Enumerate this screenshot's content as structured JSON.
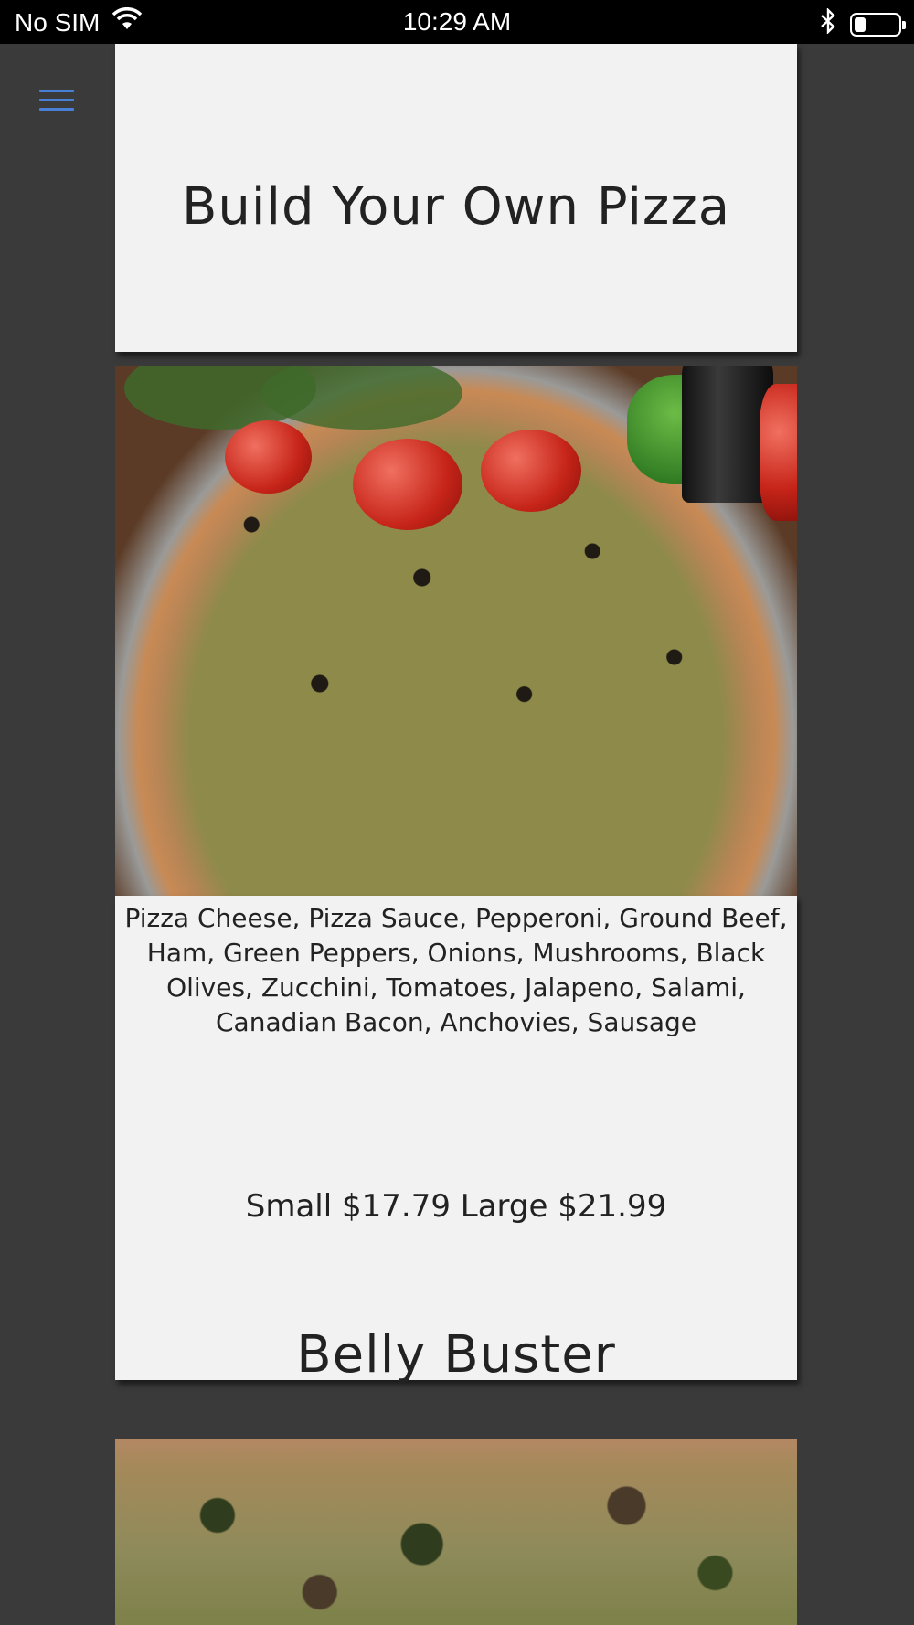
{
  "status_bar": {
    "carrier": "No SIM",
    "time": "10:29 AM",
    "battery_level": 0.25
  },
  "icons": {
    "menu": "hamburger-menu-icon",
    "wifi": "wifi-icon",
    "bluetooth": "bluetooth-icon",
    "battery": "battery-icon"
  },
  "colors": {
    "menu_accent": "#4a7fd6",
    "page_background": "#3a3a3a",
    "card_background": "#f2f2f2"
  },
  "menu_items": [
    {
      "title": "Build Your Own Pizza",
      "photo": "pizza-photo",
      "description": "Pizza Cheese, Pizza Sauce, Pepperoni, Ground Beef, Ham, Green Peppers, Onions, Mushrooms, Black Olives, Zucchini, Tomatoes, Jalapeno, Salami, Canadian Bacon, Anchovies, Sausage",
      "prices": "Small $17.79  Large $21.99"
    },
    {
      "title": "Belly Buster",
      "photo": "pizza-photo"
    }
  ]
}
